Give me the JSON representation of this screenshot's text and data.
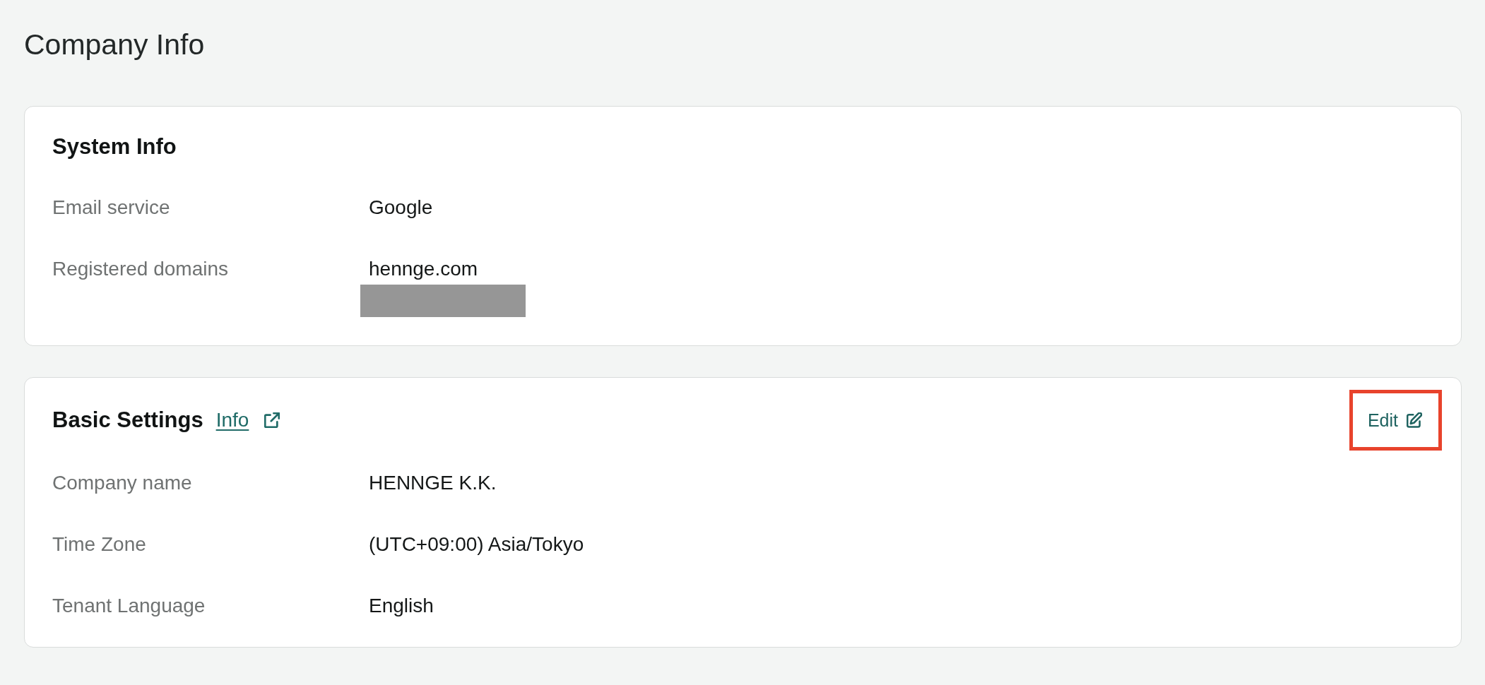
{
  "page": {
    "title": "Company Info"
  },
  "cards": [
    {
      "title": "System Info",
      "rows": [
        {
          "label": "Email service",
          "values": [
            {
              "kind": "text",
              "text": "Google"
            }
          ]
        },
        {
          "label": "Registered domains",
          "values": [
            {
              "kind": "text",
              "text": "hennge.com"
            },
            {
              "kind": "redacted"
            }
          ]
        }
      ]
    },
    {
      "title": "Basic Settings",
      "link": {
        "label": "Info",
        "external": true
      },
      "edit_button": {
        "label": "Edit",
        "highlighted": true
      },
      "rows": [
        {
          "label": "Company name",
          "values": [
            {
              "kind": "text",
              "text": "HENNGE K.K."
            }
          ]
        },
        {
          "label": "Time Zone",
          "values": [
            {
              "kind": "text",
              "text": "(UTC+09:00) Asia/Tokyo"
            }
          ]
        },
        {
          "label": "Tenant Language",
          "values": [
            {
              "kind": "text",
              "text": "English"
            }
          ]
        }
      ]
    }
  ]
}
